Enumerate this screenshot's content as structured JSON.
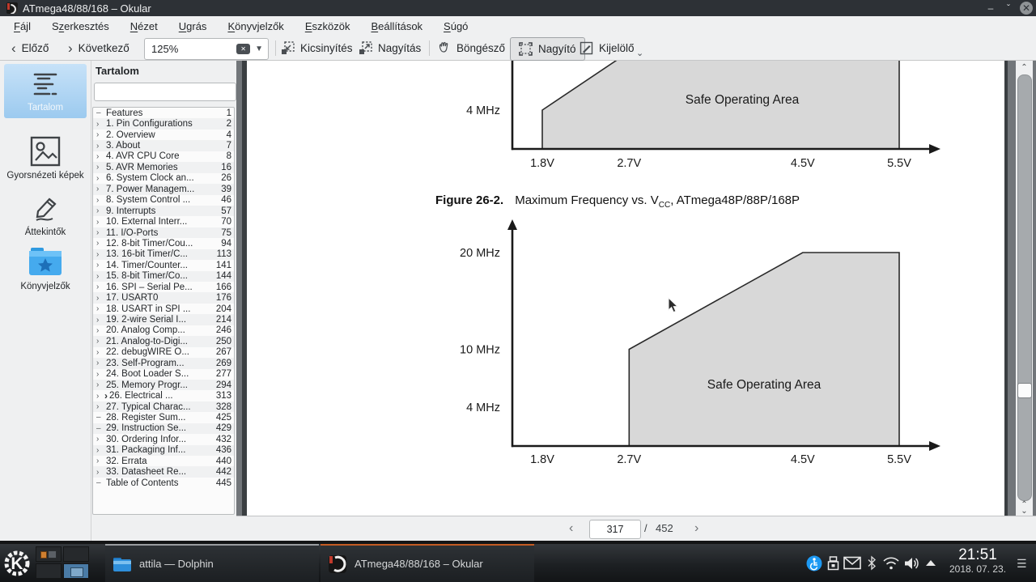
{
  "window": {
    "title": "ATmega48/88/168 – Okular",
    "controls": {
      "minimize": "–",
      "maximize": "ˇ",
      "close": "✕"
    }
  },
  "menubar": {
    "items": [
      {
        "pre": "",
        "key": "F",
        "post": "ájl"
      },
      {
        "pre": "S",
        "key": "z",
        "post": "erkesztés"
      },
      {
        "pre": "",
        "key": "N",
        "post": "ézet"
      },
      {
        "pre": "",
        "key": "U",
        "post": "grás"
      },
      {
        "pre": "",
        "key": "K",
        "post": "önyvjelzők"
      },
      {
        "pre": "",
        "key": "E",
        "post": "szközök"
      },
      {
        "pre": "",
        "key": "B",
        "post": "eállítások"
      },
      {
        "pre": "",
        "key": "S",
        "post": "úgó"
      }
    ]
  },
  "toolbar": {
    "prev_label": "Előző",
    "next_label": "Következő",
    "zoom_value": "125%",
    "zoom_out_label": "Kicsinyítés",
    "zoom_in_label": "Nagyítás",
    "browse_label": "Böngésző",
    "magnifier_label": "Nagyító",
    "selection_label": "Kijelölő"
  },
  "sidebar": {
    "items": [
      {
        "label": "Tartalom",
        "selected": true
      },
      {
        "label": "Gyorsnézeti képek"
      },
      {
        "label": "Áttekintők"
      },
      {
        "label": "Könyvjelzők"
      }
    ]
  },
  "toc": {
    "title": "Tartalom",
    "search_value": "",
    "items": [
      {
        "lead": "–",
        "curmark": "",
        "label": "Features",
        "page": "1"
      },
      {
        "lead": "›",
        "curmark": "",
        "label": "1. Pin Configurations",
        "page": "2"
      },
      {
        "lead": "›",
        "curmark": "",
        "label": "2. Overview",
        "page": "4"
      },
      {
        "lead": "›",
        "curmark": "",
        "label": "3. About",
        "page": "7"
      },
      {
        "lead": "›",
        "curmark": "",
        "label": "4. AVR CPU Core",
        "page": "8"
      },
      {
        "lead": "›",
        "curmark": "",
        "label": "5. AVR Memories",
        "page": "16"
      },
      {
        "lead": "›",
        "curmark": "",
        "label": "6. System Clock an...",
        "page": "26"
      },
      {
        "lead": "›",
        "curmark": "",
        "label": "7. Power Managem...",
        "page": "39"
      },
      {
        "lead": "›",
        "curmark": "",
        "label": "8. System Control ...",
        "page": "46"
      },
      {
        "lead": "›",
        "curmark": "",
        "label": "9. Interrupts",
        "page": "57"
      },
      {
        "lead": "›",
        "curmark": "",
        "label": "10. External Interr...",
        "page": "70"
      },
      {
        "lead": "›",
        "curmark": "",
        "label": "11. I/O-Ports",
        "page": "75"
      },
      {
        "lead": "›",
        "curmark": "",
        "label": "12. 8-bit Timer/Cou...",
        "page": "94"
      },
      {
        "lead": "›",
        "curmark": "",
        "label": "13. 16-bit Timer/C...",
        "page": "113"
      },
      {
        "lead": "›",
        "curmark": "",
        "label": "14. Timer/Counter...",
        "page": "141"
      },
      {
        "lead": "›",
        "curmark": "",
        "label": "15. 8-bit Timer/Co...",
        "page": "144"
      },
      {
        "lead": "›",
        "curmark": "",
        "label": "16. SPI – Serial Pe...",
        "page": "166"
      },
      {
        "lead": "›",
        "curmark": "",
        "label": "17. USART0",
        "page": "176"
      },
      {
        "lead": "›",
        "curmark": "",
        "label": "18. USART in SPI ...",
        "page": "204"
      },
      {
        "lead": "›",
        "curmark": "",
        "label": "19. 2-wire Serial I...",
        "page": "214"
      },
      {
        "lead": "›",
        "curmark": "",
        "label": "20. Analog Comp...",
        "page": "246"
      },
      {
        "lead": "›",
        "curmark": "",
        "label": "21. Analog-to-Digi...",
        "page": "250"
      },
      {
        "lead": "›",
        "curmark": "",
        "label": "22. debugWIRE O...",
        "page": "267"
      },
      {
        "lead": "›",
        "curmark": "",
        "label": "23. Self-Program...",
        "page": "269"
      },
      {
        "lead": "›",
        "curmark": "",
        "label": "24. Boot Loader S...",
        "page": "277"
      },
      {
        "lead": "›",
        "curmark": "",
        "label": "25. Memory Progr...",
        "page": "294"
      },
      {
        "lead": "›",
        "curmark": "›",
        "label": "26. Electrical ...",
        "page": "313",
        "current": true
      },
      {
        "lead": "›",
        "curmark": "",
        "label": "27. Typical Charac...",
        "page": "328"
      },
      {
        "lead": "–",
        "curmark": "",
        "label": "28. Register Sum...",
        "page": "425"
      },
      {
        "lead": "–",
        "curmark": "",
        "label": "29. Instruction Se...",
        "page": "429"
      },
      {
        "lead": "›",
        "curmark": "",
        "label": "30. Ordering Infor...",
        "page": "432"
      },
      {
        "lead": "›",
        "curmark": "",
        "label": "31. Packaging Inf...",
        "page": "436"
      },
      {
        "lead": "›",
        "curmark": "",
        "label": "32. Errata",
        "page": "440"
      },
      {
        "lead": "›",
        "curmark": "",
        "label": "33. Datasheet Re...",
        "page": "442"
      },
      {
        "lead": "–",
        "curmark": "",
        "label": "Table of Contents",
        "page": "445"
      }
    ]
  },
  "chart_data": [
    {
      "type": "area",
      "region_label": "Safe Operating Area",
      "x_unit": "V",
      "y_unit": "MHz",
      "xlim": [
        1.8,
        5.5
      ],
      "ylim": [
        0,
        10
      ],
      "x_ticks": [
        {
          "v": 1.8,
          "label": "1.8V"
        },
        {
          "v": 2.7,
          "label": "2.7V"
        },
        {
          "v": 4.5,
          "label": "4.5V"
        },
        {
          "v": 5.5,
          "label": "5.5V"
        }
      ],
      "y_ticks": [
        {
          "mhz": 4,
          "label": "4 MHz"
        }
      ],
      "safe_area_polygon": [
        [
          1.8,
          0
        ],
        [
          1.8,
          4
        ],
        [
          2.7,
          10
        ],
        [
          5.5,
          10
        ],
        [
          5.5,
          0
        ]
      ]
    },
    {
      "type": "area",
      "region_label": "Safe Operating Area",
      "x_unit": "V",
      "y_unit": "MHz",
      "xlim": [
        1.8,
        5.5
      ],
      "ylim": [
        0,
        20
      ],
      "caption": {
        "prefix": "Figure 26-2.",
        "text": "Maximum Frequency vs. V",
        "sub": "CC",
        "suffix": ", ATmega48P/88P/168P"
      },
      "x_ticks": [
        {
          "v": 1.8,
          "label": "1.8V"
        },
        {
          "v": 2.7,
          "label": "2.7V"
        },
        {
          "v": 4.5,
          "label": "4.5V"
        },
        {
          "v": 5.5,
          "label": "5.5V"
        }
      ],
      "y_ticks": [
        {
          "mhz": 20,
          "label": "20 MHz"
        },
        {
          "mhz": 10,
          "label": "10 MHz"
        },
        {
          "mhz": 4,
          "label": "4 MHz"
        }
      ],
      "safe_area_polygon": [
        [
          2.7,
          0
        ],
        [
          2.7,
          10
        ],
        [
          4.5,
          20
        ],
        [
          5.5,
          20
        ],
        [
          5.5,
          0
        ]
      ]
    }
  ],
  "navbar": {
    "current_page": "317",
    "separator": "/",
    "total_pages": "452"
  },
  "taskbar": {
    "tasks": [
      {
        "label": "attila — Dolphin",
        "icon": "dolphin-folder",
        "active": false
      },
      {
        "label": "ATmega48/88/168 – Okular",
        "icon": "okular",
        "active": true
      }
    ],
    "tray_icons": [
      "accessibility",
      "removable-device",
      "mail",
      "bluetooth",
      "wifi",
      "volume",
      "expand-caret"
    ],
    "clock": {
      "time": "21:51",
      "date": "2018. 07. 23."
    }
  }
}
